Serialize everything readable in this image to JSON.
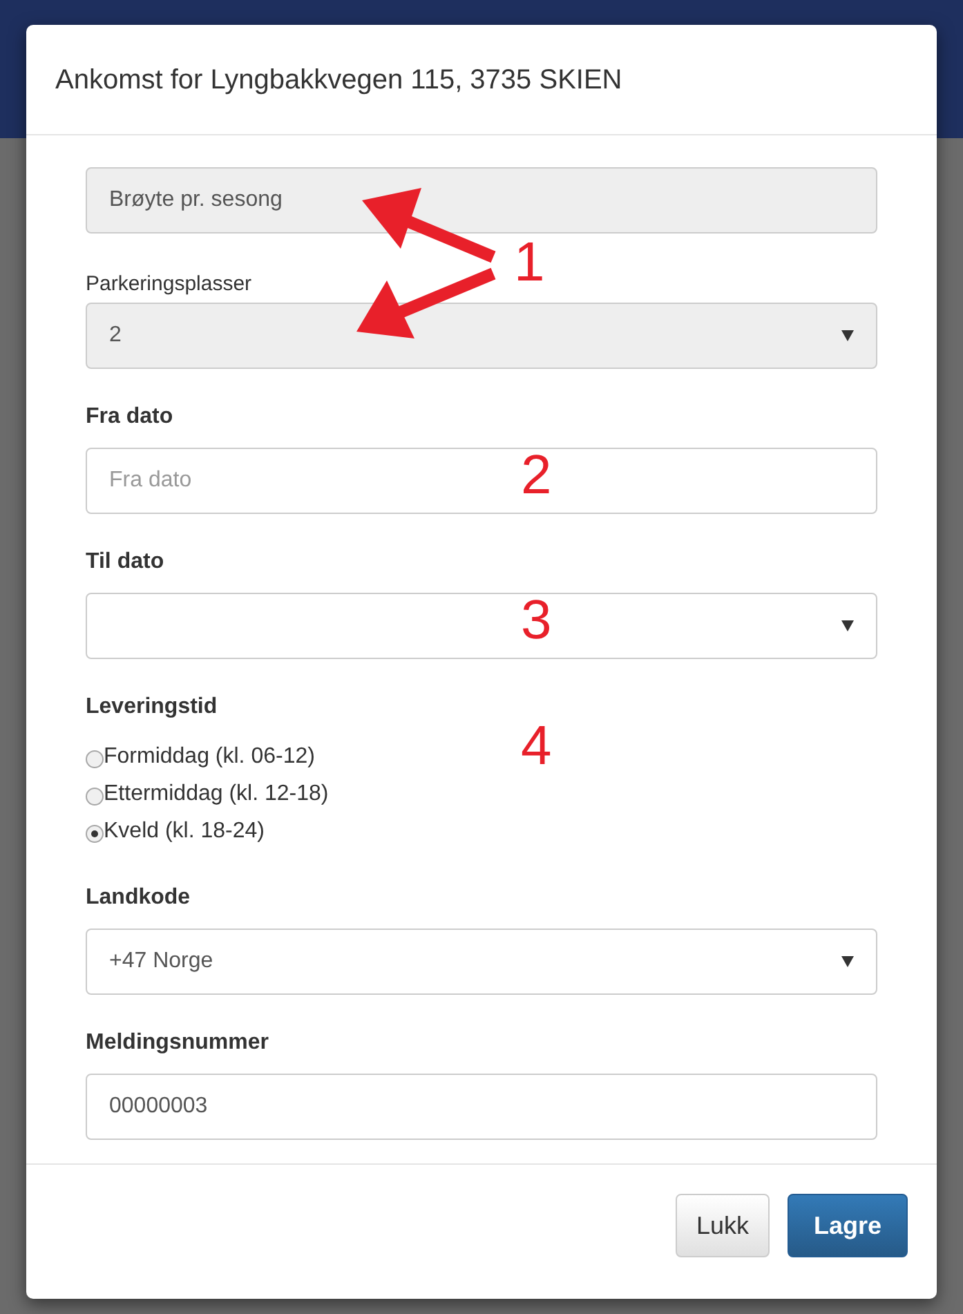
{
  "modal": {
    "title": "Ankomst for Lyngbakkvegen 115, 3735 SKIEN"
  },
  "fields": [
    {
      "kind": "input",
      "value": "Brøyte pr. sesong",
      "disabled": true
    },
    {
      "kind": "select",
      "label": "Parkeringsplasser",
      "label_bold": false,
      "value": "2",
      "disabled": true
    },
    {
      "kind": "input",
      "label": "Fra dato",
      "label_bold": true,
      "placeholder": "Fra dato",
      "disabled": false
    },
    {
      "kind": "select",
      "label": "Til dato",
      "label_bold": true,
      "disabled": false
    },
    {
      "kind": "radio_group",
      "label": "Leveringstid",
      "label_bold": true,
      "options": [
        {
          "label": "Formiddag (kl. 06-12)",
          "selected": false
        },
        {
          "label": "Ettermiddag (kl. 12-18)",
          "selected": false
        },
        {
          "label": "Kveld (kl. 18-24)",
          "selected": true
        }
      ]
    },
    {
      "kind": "select",
      "label": "Landkode",
      "label_bold": true,
      "value": "+47 Norge",
      "disabled": false
    },
    {
      "kind": "input",
      "label": "Meldingsnummer",
      "label_bold": true,
      "value": "00000003",
      "disabled": false
    }
  ],
  "buttons": [
    {
      "label": "Lukk",
      "kind": "default"
    },
    {
      "label": "Lagre",
      "kind": "primary"
    }
  ],
  "annotations": [
    {
      "text": "1",
      "arrows": true
    },
    {
      "text": "2",
      "arrows": false
    },
    {
      "text": "3",
      "arrows": false
    },
    {
      "text": "4",
      "arrows": false
    }
  ]
}
